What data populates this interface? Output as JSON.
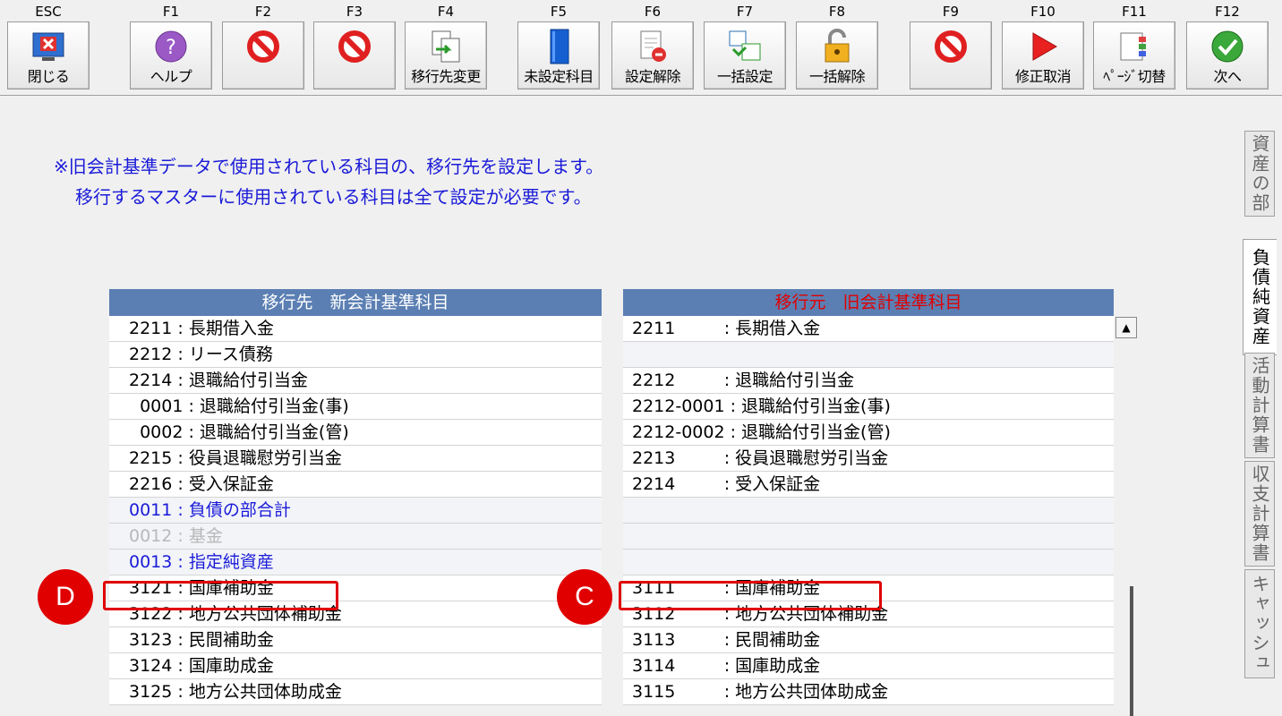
{
  "toolbar": {
    "keys": [
      {
        "key": "ESC",
        "label": "閉じる",
        "icon": "close-window-icon"
      },
      {
        "key": "F1",
        "label": "ヘルプ",
        "icon": "help-icon"
      },
      {
        "key": "F2",
        "label": "",
        "icon": "prohibited-icon"
      },
      {
        "key": "F3",
        "label": "",
        "icon": "prohibited-icon"
      },
      {
        "key": "F4",
        "label": "移行先変更",
        "icon": "transfer-change-icon"
      },
      {
        "key": "F5",
        "label": "未設定科目",
        "icon": "unset-book-icon"
      },
      {
        "key": "F6",
        "label": "設定解除",
        "icon": "document-remove-icon"
      },
      {
        "key": "F7",
        "label": "一括設定",
        "icon": "batch-set-icon"
      },
      {
        "key": "F8",
        "label": "一括解除",
        "icon": "unlock-icon"
      },
      {
        "key": "F9",
        "label": "",
        "icon": "prohibited-icon"
      },
      {
        "key": "F10",
        "label": "修正取消",
        "icon": "undo-play-icon"
      },
      {
        "key": "F11",
        "label": "ﾍﾟｰｼﾞ切替",
        "icon": "page-switch-icon"
      },
      {
        "key": "F12",
        "label": "次へ",
        "icon": "check-next-icon"
      }
    ]
  },
  "instructions": {
    "line1": "※旧会計基準データで使用されている科目の、移行先を設定します。",
    "line2": "移行するマスターに使用されている科目は全て設定が必要です。"
  },
  "side_tabs": [
    {
      "label": "資産の部",
      "active": false
    },
    {
      "label": "負債純資産",
      "active": true
    },
    {
      "label": "活動計算書",
      "active": false
    },
    {
      "label": "収支計算書",
      "active": false
    },
    {
      "label": "キャッシュ",
      "active": false
    }
  ],
  "left_panel": {
    "header": "移行先　新会計基準科目",
    "rows": [
      {
        "text": "2211 : 長期借入金",
        "style": "normal"
      },
      {
        "text": "2212 : リース債務",
        "style": "normal"
      },
      {
        "text": "2214 : 退職給付引当金",
        "style": "normal"
      },
      {
        "text": "  0001 : 退職給付引当金(事)",
        "style": "normal"
      },
      {
        "text": "  0002 : 退職給付引当金(管)",
        "style": "normal"
      },
      {
        "text": "2215 : 役員退職慰労引当金",
        "style": "normal"
      },
      {
        "text": "2216 : 受入保証金",
        "style": "normal"
      },
      {
        "text": "0011 : 負債の部合計",
        "style": "blue"
      },
      {
        "text": "0012 : 基金",
        "style": "dim"
      },
      {
        "text": "0013 : 指定純資産",
        "style": "blue"
      },
      {
        "text": "3121 : 国庫補助金",
        "style": "normal"
      },
      {
        "text": "3122 : 地方公共団体補助金",
        "style": "normal"
      },
      {
        "text": "3123 : 民間補助金",
        "style": "normal"
      },
      {
        "text": "3124 : 国庫助成金",
        "style": "normal"
      },
      {
        "text": "3125 : 地方公共団体助成金",
        "style": "normal"
      }
    ]
  },
  "right_panel": {
    "header": "移行元　旧会計基準科目",
    "rows": [
      {
        "text": "2211         : 長期借入金",
        "style": "normal"
      },
      {
        "text": "",
        "style": "gray"
      },
      {
        "text": "2212         : 退職給付引当金",
        "style": "normal"
      },
      {
        "text": "2212-0001 : 退職給付引当金(事)",
        "style": "normal"
      },
      {
        "text": "2212-0002 : 退職給付引当金(管)",
        "style": "normal"
      },
      {
        "text": "2213         : 役員退職慰労引当金",
        "style": "normal"
      },
      {
        "text": "2214         : 受入保証金",
        "style": "normal"
      },
      {
        "text": "",
        "style": "gray"
      },
      {
        "text": "",
        "style": "gray"
      },
      {
        "text": "",
        "style": "gray"
      },
      {
        "text": "3111         : 国庫補助金",
        "style": "normal"
      },
      {
        "text": "3112         : 地方公共団体補助金",
        "style": "normal"
      },
      {
        "text": "3113         : 民間補助金",
        "style": "normal"
      },
      {
        "text": "3114         : 国庫助成金",
        "style": "normal"
      },
      {
        "text": "3115         : 地方公共団体助成金",
        "style": "normal"
      }
    ]
  },
  "annotations": {
    "left_badge": "D",
    "right_badge": "C"
  },
  "colors": {
    "header_bg": "#5b7fb3",
    "instruction_text": "#1a1ad8",
    "highlight": "#e00000"
  }
}
